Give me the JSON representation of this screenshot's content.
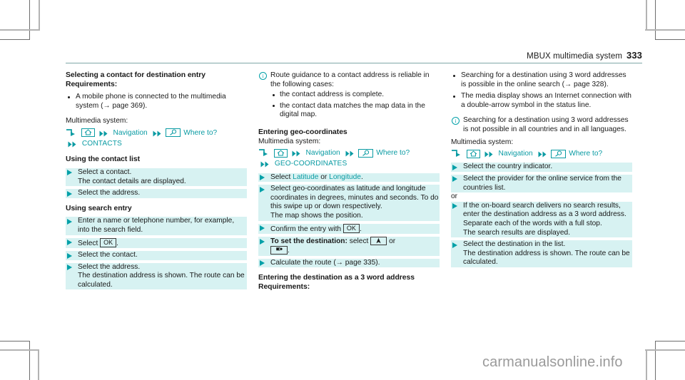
{
  "header": {
    "title": "MBUX multimedia system",
    "page_number": "333"
  },
  "watermark": "carmanualsonline.info",
  "columns": {
    "left": {
      "heading": "Selecting a contact for destination entry",
      "requirements_label": "Requirements:",
      "requirement_bullets": [
        "A mobile phone is connected to the multimedia system (→ page 369)."
      ],
      "multimedia_label": "Multimedia system:",
      "navpath": {
        "home_label": "",
        "nav_label": "Navigation",
        "where_to_label": "Where to?",
        "final_label": "CONTACTS"
      },
      "subheading_1": "Using the contact list",
      "steps_1": [
        "Select a contact.\nThe contact details are displayed.",
        "Select the address."
      ],
      "subheading_2": "Using search entry",
      "steps_2": [
        "Enter a name or telephone number, for example, into the search field.",
        "Select OK .",
        "Select the contact.",
        "Select the address.\nThe destination address is shown. The route can be calculated."
      ],
      "step_ok_label": "OK"
    },
    "middle": {
      "note_text": "Route guidance to a contact address is reliable in the following cases:",
      "note_bullets": [
        "the contact address is complete.",
        "the contact data matches the map data in the digital map."
      ],
      "heading": "Entering geo-coordinates",
      "multimedia_label": "Multimedia system:",
      "navpath": {
        "nav_label": "Navigation",
        "where_to_label": "Where to?",
        "final_label": "GEO-COORDINATES"
      },
      "steps": [
        "Select Latitude or Longitude.",
        "Select geo-coordinates as latitude and longitude coordinates in degrees, minutes and seconds. To do this swipe up or down respectively.\nThe map shows the position.",
        "Confirm the entry with OK .",
        "To set the destination: select ▲ or ⚑ .",
        "Calculate the route (→ page 335)."
      ],
      "link_latitude": "Latitude",
      "link_or": "or",
      "link_longitude": "Longitude",
      "ok_label": "OK",
      "set_dest_bold": "To set the destination:",
      "set_dest_rest": "select",
      "set_dest_or": "or",
      "calc_route": "Calculate the route (→ page 335).",
      "heading_2": "Entering the destination as a 3 word address",
      "requirements_label": "Requirements:"
    },
    "right": {
      "bullets": [
        "Searching for a destination using 3 word addresses is possible in the online search (→ page 328).",
        "The media display shows an Internet connection with a double-arrow symbol in the status line."
      ],
      "note_text": "Searching for a destination using 3 word addresses is not possible in all countries and in all languages.",
      "multimedia_label": "Multimedia system:",
      "navpath": {
        "nav_label": "Navigation",
        "where_to_label": "Where to?"
      },
      "steps_1": [
        "Select the country indicator.",
        "Select the provider for the online service from the countries list."
      ],
      "or_label": "or",
      "steps_2": [
        "If the on-board search delivers no search results, enter the destination address as a 3 word address. Separate each of the words with a full stop.\nThe search results are displayed.",
        "Select the destination in the list.\nThe destination address is shown. The route can be calculated."
      ]
    }
  },
  "colors": {
    "teal": "#0a9ba3",
    "highlight": "#d7f2f2",
    "rule": "#7fa8a8"
  },
  "icons": {
    "enter_arrow": "enter-arrow-icon",
    "home": "home-icon",
    "double_arrow": "double-arrow-icon",
    "search": "search-magnifier-icon",
    "navigation_arrow": "navigation-arrow-icon",
    "destination_flag": "destination-flag-icon",
    "info": "info-circle-icon"
  }
}
